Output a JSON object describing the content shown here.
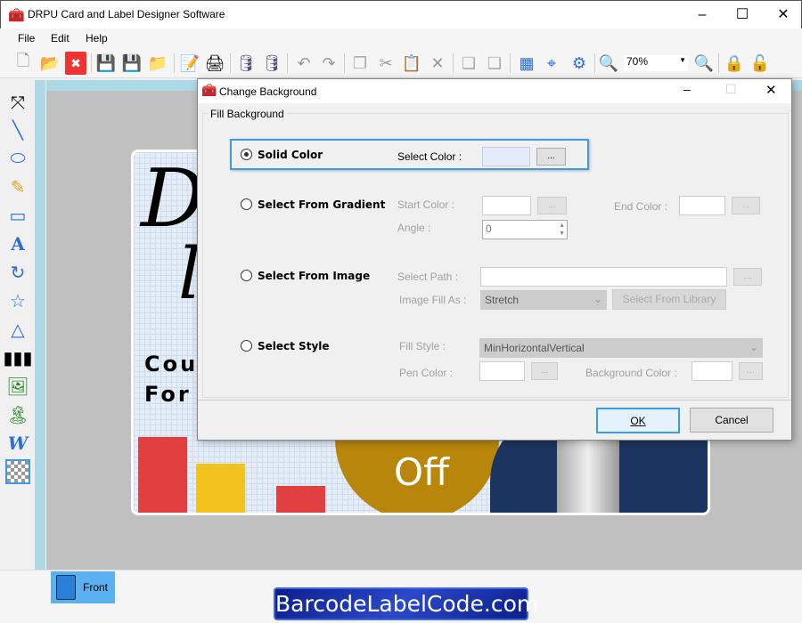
{
  "app": {
    "title": "DRPU Card and Label Designer Software"
  },
  "menu": [
    "File",
    "Edit",
    "Help"
  ],
  "toolbar": {
    "zoom": "70%",
    "icons": [
      "new-icon",
      "open-icon",
      "close-icon",
      "save-icon",
      "save-as-icon",
      "export-icon",
      "properties-icon",
      "print-icon",
      "database-add-icon",
      "database-icon",
      "undo-icon",
      "redo-icon",
      "copy-icon",
      "cut-icon",
      "paste-icon",
      "delete-icon",
      "bring-front-icon",
      "send-back-icon",
      "grid-icon",
      "fit-icon",
      "center-icon",
      "zoom-in-icon",
      "zoom-out-icon",
      "lock-icon",
      "unlock-icon"
    ]
  },
  "card": {
    "line1": "Coupon",
    "line2": "For",
    "discount": "Off",
    "colors": {
      "gold": "#b8860b",
      "navy": "#1b3560"
    }
  },
  "tabs": {
    "front": "Front"
  },
  "watermark": "BarcodeLabelCode.com",
  "dialog": {
    "title": "Change Background",
    "group": "Fill Background",
    "solid": {
      "label": "Solid Color",
      "select_color": "Select Color :",
      "color": "#e3ecfa",
      "dots": "..."
    },
    "gradient": {
      "label": "Select From Gradient",
      "start": "Start Color :",
      "end": "End Color :",
      "angle": "Angle :",
      "angle_value": "0",
      "dots": "..."
    },
    "image": {
      "label": "Select From Image",
      "path": "Select Path :",
      "fill_as": "Image Fill As :",
      "fill_value": "Stretch",
      "library": "Select From Library",
      "dots": "..."
    },
    "style": {
      "label": "Select Style",
      "fill_style": "Fill Style :",
      "fill_value": "MinHorizontalVertical",
      "pen": "Pen Color :",
      "bg": "Background Color :",
      "dots": "..."
    },
    "ok": "OK",
    "cancel": "Cancel",
    "selected": "solid"
  },
  "colors": {
    "accent": "#3c9be8",
    "ruler": "#add8e6"
  }
}
